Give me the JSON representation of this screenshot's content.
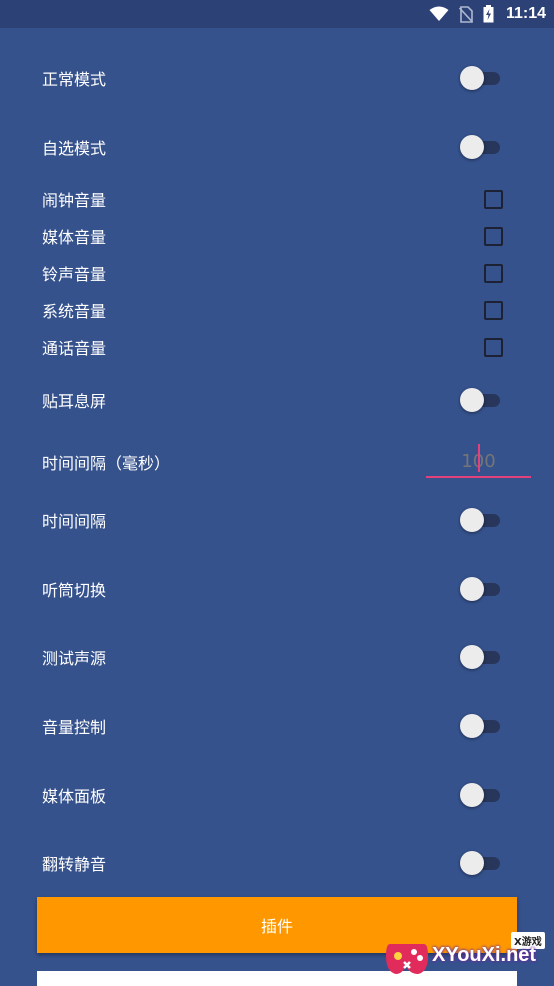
{
  "status_bar": {
    "time": "11:14",
    "icons": [
      "wifi-icon",
      "no-sim-icon",
      "battery-charging-icon"
    ]
  },
  "settings": [
    {
      "label": "正常模式",
      "control": "switch",
      "on": false
    },
    {
      "label": "自选模式",
      "control": "switch",
      "on": false
    },
    {
      "label": "闹钟音量",
      "control": "checkbox",
      "checked": false
    },
    {
      "label": "媒体音量",
      "control": "checkbox",
      "checked": false
    },
    {
      "label": "铃声音量",
      "control": "checkbox",
      "checked": false
    },
    {
      "label": "系统音量",
      "control": "checkbox",
      "checked": false
    },
    {
      "label": "通话音量",
      "control": "checkbox",
      "checked": false
    },
    {
      "label": "贴耳息屏",
      "control": "switch",
      "on": false
    },
    {
      "label": "时间间隔（毫秒）",
      "control": "input",
      "placeholder": "100"
    },
    {
      "label": "时间间隔",
      "control": "switch",
      "on": false
    },
    {
      "label": "听筒切换",
      "control": "switch",
      "on": false
    },
    {
      "label": "测试声源",
      "control": "switch",
      "on": false
    },
    {
      "label": "音量控制",
      "control": "switch",
      "on": false
    },
    {
      "label": "媒体面板",
      "control": "switch",
      "on": false
    },
    {
      "label": "翻转静音",
      "control": "switch",
      "on": false
    }
  ],
  "plugin_button": {
    "label": "插件"
  },
  "watermark": {
    "badge": "X游戏",
    "text": "XYouXi.net"
  },
  "colors": {
    "background": "#35528D",
    "status_bar": "#2C4277",
    "accent": "#FF9800",
    "input_underline": "#E4407B"
  }
}
